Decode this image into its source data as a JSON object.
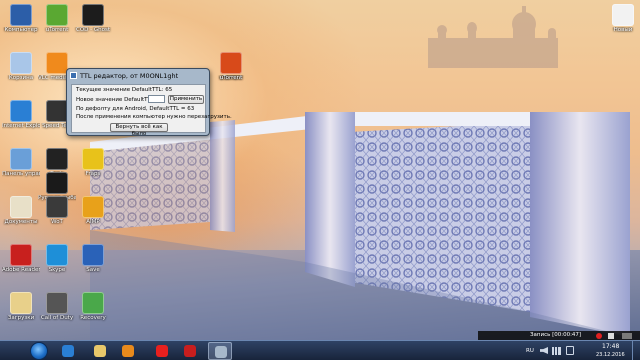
{
  "desktop": {
    "icons": [
      {
        "label": "Компьютер",
        "icon": "computer-icon",
        "color": "#2c5ea8"
      },
      {
        "label": "uTorrent",
        "icon": "utorrent-icon",
        "color": "#5aa832"
      },
      {
        "label": "COD - Ghost",
        "icon": "cod-ghosts-icon",
        "color": "#1c1c1c"
      },
      {
        "label": "Корзина",
        "icon": "recycle-bin-icon",
        "color": "#a9c6e8"
      },
      {
        "label": "VLC media player",
        "icon": "vlc-icon",
        "color": "#f08a1c"
      },
      {
        "label": "uTorrent",
        "icon": "shortcut-icon",
        "color": "#c8c8c8"
      },
      {
        "label": "Internet Explorer",
        "icon": "ie-icon",
        "color": "#2a7fd4"
      },
      {
        "label": "Speed Test",
        "icon": "speedtest-icon",
        "color": "#333333"
      },
      {
        "label": "Панель управления",
        "icon": "control-panel-icon",
        "color": "#6a9fd8"
      },
      {
        "label": "Tools",
        "icon": "tools-icon",
        "color": "#222222"
      },
      {
        "label": "Fraps",
        "icon": "fraps-icon",
        "color": "#e8c21a"
      },
      {
        "label": "Русская рыбалка",
        "icon": "game-icon",
        "color": "#1a1a1a"
      },
      {
        "label": "Документы",
        "icon": "documents-icon",
        "color": "#e8e0c8"
      },
      {
        "label": "WoT",
        "icon": "wot-icon",
        "color": "#3a3a3a"
      },
      {
        "label": "AIMP",
        "icon": "aimp-icon",
        "color": "#e8a11a"
      },
      {
        "label": "Adobe Reader",
        "icon": "pdf-icon",
        "color": "#c8201e"
      },
      {
        "label": "Skype",
        "icon": "skype-icon",
        "color": "#1e8fd8"
      },
      {
        "label": "Save",
        "icon": "save-icon",
        "color": "#2a62b8"
      },
      {
        "label": "Загрузки",
        "icon": "folder-icon",
        "color": "#e8d08a"
      },
      {
        "label": "Call of Duty",
        "icon": "cod-icon",
        "color": "#555555"
      },
      {
        "label": "Recovery",
        "icon": "recovery-icon",
        "color": "#4aa84a"
      },
      {
        "label": "Новый",
        "icon": "document-icon",
        "color": "#f2f2f2"
      },
      {
        "label": "uTorrent",
        "icon": "app-icon",
        "color": "#d84a1a"
      }
    ]
  },
  "dialog": {
    "title": "TTL редактор, от M0ONL1ght",
    "current_label": "Текущее значение DefaultTTL: 65",
    "new_label": "Новое значение DefaultTTL:",
    "new_value": "",
    "apply_label": "Применить",
    "android_note": "По дефолту для Android, DefaultTTL = 63",
    "restart_note": "После применения компьютер нужно перезагрузить.",
    "reset_label": "Вернуть всё как было"
  },
  "taskbar": {
    "pinned": [
      {
        "name": "ie-taskbar-button",
        "color": "#2a7fd4"
      },
      {
        "name": "explorer-taskbar-button",
        "color": "#e8c86a"
      },
      {
        "name": "media-player-taskbar-button",
        "color": "#e88a1c"
      },
      {
        "name": "yandex-browser-taskbar-button",
        "color": "#e8201e"
      },
      {
        "name": "record-taskbar-button",
        "color": "#c81e1e"
      },
      {
        "name": "ttl-editor-taskbar-button",
        "color": "#a7b8ca"
      }
    ],
    "recording": "Запись [00:00:47]",
    "lang": "RU",
    "time": "17:48",
    "date": "23.12.2016"
  },
  "colors": {
    "accent": "#2c5ea8",
    "dialog_frame": "#a7b8ca",
    "taskbar": "#1c2a45"
  }
}
